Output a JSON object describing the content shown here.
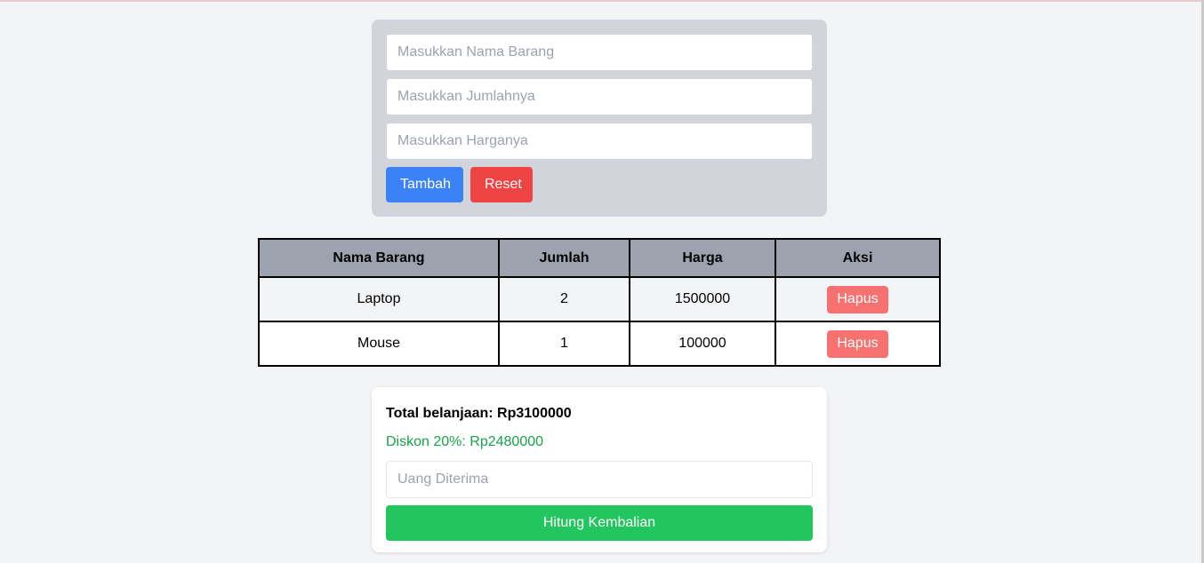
{
  "form": {
    "nama_placeholder": "Masukkan Nama Barang",
    "jumlah_placeholder": "Masukkan Jumlahnya",
    "harga_placeholder": "Masukkan Harganya",
    "tambah_label": "Tambah",
    "reset_label": "Reset"
  },
  "table": {
    "headers": [
      "Nama Barang",
      "Jumlah",
      "Harga",
      "Aksi"
    ],
    "rows": [
      {
        "nama": "Laptop",
        "jumlah": "2",
        "harga": "1500000",
        "aksi": "Hapus"
      },
      {
        "nama": "Mouse",
        "jumlah": "1",
        "harga": "100000",
        "aksi": "Hapus"
      }
    ]
  },
  "summary": {
    "total_text": "Total belanjaan: Rp3100000",
    "diskon_text": "Diskon 20%: Rp2480000",
    "uang_placeholder": "Uang Diterima",
    "hitung_label": "Hitung Kembalian"
  },
  "colors": {
    "primary_blue": "#3b82f6",
    "danger_red": "#ef4444",
    "hapus_red": "#f87171",
    "success_green": "#22c55e",
    "diskon_green": "#16a34a"
  }
}
